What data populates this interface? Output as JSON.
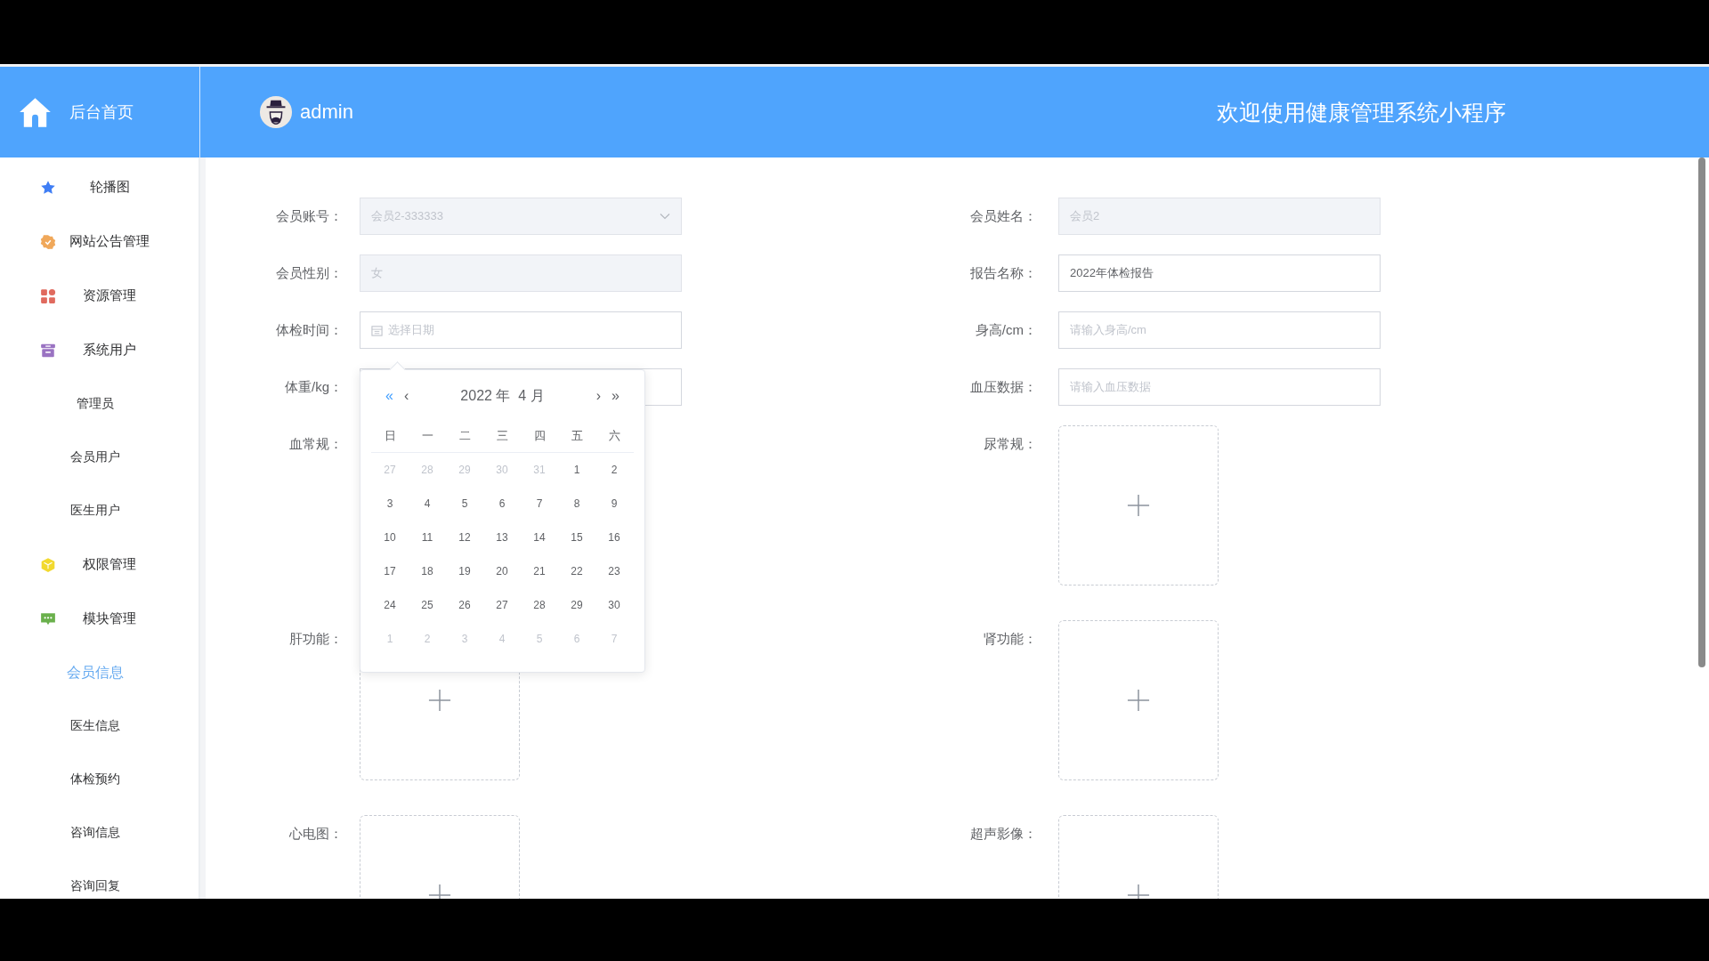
{
  "header": {
    "home": {
      "label": "后台首页"
    },
    "user": {
      "name": "admin"
    },
    "title": "欢迎使用健康管理系统小程序"
  },
  "sidebar": {
    "items": [
      {
        "label": "轮播图",
        "selected": false
      },
      {
        "label": "网站公告管理",
        "selected": false
      },
      {
        "label": "资源管理",
        "selected": false
      },
      {
        "label": "系统用户",
        "selected": false,
        "children": [
          {
            "label": "管理员",
            "selected": false
          },
          {
            "label": "会员用户",
            "selected": false
          },
          {
            "label": "医生用户",
            "selected": false
          }
        ]
      },
      {
        "label": "权限管理",
        "selected": false
      },
      {
        "label": "模块管理",
        "selected": false,
        "children": [
          {
            "label": "会员信息",
            "selected": true
          },
          {
            "label": "医生信息",
            "selected": false
          },
          {
            "label": "体检预约",
            "selected": false
          },
          {
            "label": "咨询信息",
            "selected": false
          },
          {
            "label": "咨询回复",
            "selected": false
          }
        ]
      }
    ]
  },
  "form": {
    "left": [
      {
        "kind": "select",
        "label": "会员账号：",
        "value": "会员2-333333",
        "disabled": true
      },
      {
        "kind": "text",
        "label": "会员性别：",
        "value": "女",
        "disabled": true
      },
      {
        "kind": "date",
        "label": "体检时间：",
        "placeholder": "选择日期",
        "disabled": false
      },
      {
        "kind": "text",
        "label": "体重/kg：",
        "disabled": false
      },
      {
        "kind": "covered",
        "label": "血常规："
      },
      {
        "kind": "upload",
        "label": "肝功能："
      },
      {
        "kind": "upload",
        "label": "心电图："
      }
    ],
    "right": [
      {
        "kind": "text",
        "label": "会员姓名：",
        "value": "会员2",
        "disabled": true
      },
      {
        "kind": "text",
        "label": "报告名称：",
        "value": "2022年体检报告",
        "disabled": false
      },
      {
        "kind": "text",
        "label": "身高/cm：",
        "placeholder": "请输入身高/cm",
        "disabled": false
      },
      {
        "kind": "text",
        "label": "血压数据：",
        "placeholder": "请输入血压数据",
        "disabled": false
      },
      {
        "kind": "upload",
        "label": "尿常规："
      },
      {
        "kind": "upload",
        "label": "肾功能："
      },
      {
        "kind": "upload",
        "label": "超声影像："
      }
    ]
  },
  "date_picker": {
    "nav_left": [
      {
        "symbol": "«",
        "hovered": true
      },
      {
        "symbol": "‹",
        "hovered": false
      }
    ],
    "title": "2022 年  4 月",
    "nav_right": [
      {
        "symbol": "›",
        "hovered": false
      },
      {
        "symbol": "»",
        "hovered": false
      }
    ],
    "weekdays": [
      "日",
      "一",
      "二",
      "三",
      "四",
      "五",
      "六"
    ],
    "weeks": [
      [
        {
          "text": "27",
          "current_month": false
        },
        {
          "text": "28",
          "current_month": false
        },
        {
          "text": "29",
          "current_month": false
        },
        {
          "text": "30",
          "current_month": false
        },
        {
          "text": "31",
          "current_month": false
        },
        {
          "text": "1",
          "current_month": true
        },
        {
          "text": "2",
          "current_month": true
        }
      ],
      [
        {
          "text": "3",
          "current_month": true
        },
        {
          "text": "4",
          "current_month": true
        },
        {
          "text": "5",
          "current_month": true
        },
        {
          "text": "6",
          "current_month": true
        },
        {
          "text": "7",
          "current_month": true
        },
        {
          "text": "8",
          "current_month": true
        },
        {
          "text": "9",
          "current_month": true
        }
      ],
      [
        {
          "text": "10",
          "current_month": true
        },
        {
          "text": "11",
          "current_month": true
        },
        {
          "text": "12",
          "current_month": true
        },
        {
          "text": "13",
          "current_month": true
        },
        {
          "text": "14",
          "current_month": true
        },
        {
          "text": "15",
          "current_month": true
        },
        {
          "text": "16",
          "current_month": true
        }
      ],
      [
        {
          "text": "17",
          "current_month": true
        },
        {
          "text": "18",
          "current_month": true
        },
        {
          "text": "19",
          "current_month": true
        },
        {
          "text": "20",
          "current_month": true
        },
        {
          "text": "21",
          "current_month": true
        },
        {
          "text": "22",
          "current_month": true
        },
        {
          "text": "23",
          "current_month": true
        }
      ],
      [
        {
          "text": "24",
          "current_month": true
        },
        {
          "text": "25",
          "current_month": true
        },
        {
          "text": "26",
          "current_month": true
        },
        {
          "text": "27",
          "current_month": true
        },
        {
          "text": "28",
          "current_month": true
        },
        {
          "text": "29",
          "current_month": true
        },
        {
          "text": "30",
          "current_month": true
        }
      ],
      [
        {
          "text": "1",
          "current_month": false
        },
        {
          "text": "2",
          "current_month": false
        },
        {
          "text": "3",
          "current_month": false
        },
        {
          "text": "4",
          "current_month": false
        },
        {
          "text": "5",
          "current_month": false
        },
        {
          "text": "6",
          "current_month": false
        },
        {
          "text": "7",
          "current_month": false
        }
      ]
    ]
  }
}
